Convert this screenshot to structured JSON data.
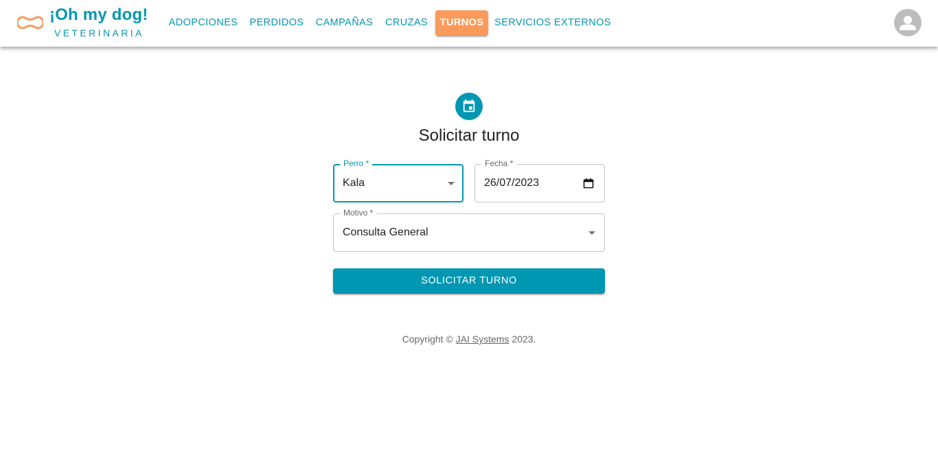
{
  "header": {
    "brand_title": "¡Oh my dog!",
    "brand_subtitle": "VETERINARIA",
    "nav": [
      {
        "label": "ADOPCIONES",
        "active": false
      },
      {
        "label": "PERDIDOS",
        "active": false
      },
      {
        "label": "CAMPAÑAS",
        "active": false
      },
      {
        "label": "CRUZAS",
        "active": false
      },
      {
        "label": "TURNOS",
        "active": true
      },
      {
        "label": "SERVICIOS EXTERNOS",
        "active": false
      }
    ],
    "logo_icon": "bone-icon",
    "avatar_icon": "person-icon"
  },
  "form": {
    "icon": "calendar-icon",
    "title": "Solicitar turno",
    "perro": {
      "label": "Perro *",
      "value": "Kala"
    },
    "fecha": {
      "label": "Fecha *",
      "value": "26/07/2023"
    },
    "motivo": {
      "label": "Motivo *",
      "value": "Consulta General"
    },
    "submit_label": "SOLICITAR TURNO"
  },
  "footer": {
    "prefix": "Copyright © ",
    "link": "JAI Systems",
    "suffix": " 2023."
  },
  "colors": {
    "primary": "#0097b2",
    "accent": "#fb9a5a",
    "logo": "#f4a06b"
  }
}
